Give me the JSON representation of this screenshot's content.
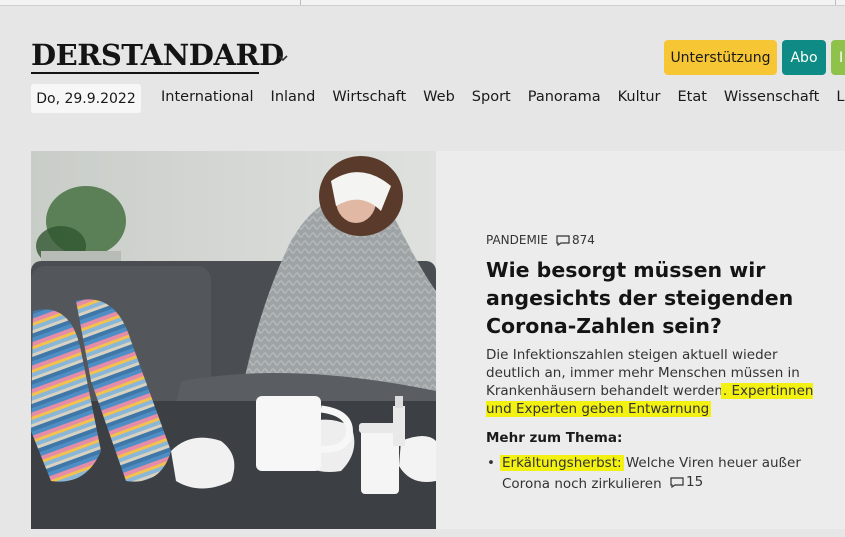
{
  "header": {
    "logo_text": "DERSTANDARD",
    "support_button": "Unterstützung",
    "abo_button": "Abo",
    "partial_button": "I"
  },
  "date": "Do, 29.9.2022",
  "nav": {
    "items": [
      "International",
      "Inland",
      "Wirtschaft",
      "Web",
      "Sport",
      "Panorama",
      "Kultur",
      "Etat",
      "Wissenschaft",
      "Lif"
    ]
  },
  "article": {
    "kicker": "PANDEMIE",
    "comment_count": "874",
    "headline": "Wie besorgt müssen wir angesichts der steigenden Corona-Zahlen sein?",
    "teaser_plain": "Die Infektionszahlen steigen aktuell wieder deutlich an, immer mehr Menschen müssen in Krankenhäusern behandelt werden",
    "teaser_highlighted": ". Expertinnen und Experten geben Entwarnung",
    "more_title": "Mehr zum Thema:",
    "related": [
      {
        "highlight": "Erkältungsherbst:",
        "text": " Welche Viren heuer außer Corona noch zirkulieren",
        "comments": "15"
      }
    ]
  },
  "colors": {
    "support_button": "#f7c635",
    "abo_button": "#0e8b84",
    "partial_button": "#8fc24a",
    "highlight": "#f3f112",
    "background": "#e6e6e6"
  },
  "icons": {
    "menu_chevron": "chevron-down-icon",
    "comments": "comment-bubble-icon"
  }
}
